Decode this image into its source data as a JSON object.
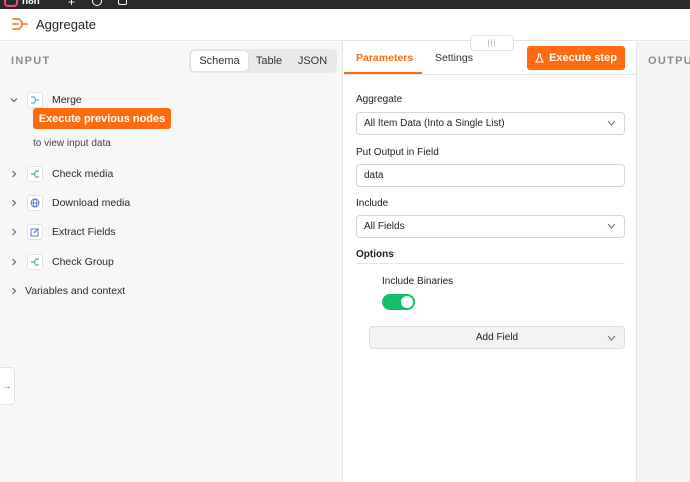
{
  "app": {
    "name": "n8n"
  },
  "header": {
    "title": "Aggregate"
  },
  "input": {
    "label": "INPUT",
    "view_options": [
      "Schema",
      "Table",
      "JSON"
    ],
    "active_view": "Schema",
    "execute_previous_label": "Execute previous nodes",
    "view_hint": "to view input data",
    "nodes": [
      {
        "label": "Merge",
        "icon": "merge-icon",
        "expanded": true
      },
      {
        "label": "Check media",
        "icon": "switch-icon",
        "expanded": false
      },
      {
        "label": "Download media",
        "icon": "globe-icon",
        "expanded": false
      },
      {
        "label": "Extract Fields",
        "icon": "edit-icon",
        "expanded": false
      },
      {
        "label": "Check Group",
        "icon": "switch-icon",
        "expanded": false
      }
    ],
    "variables_label": "Variables and context"
  },
  "params": {
    "tabs": [
      "Parameters",
      "Settings"
    ],
    "active_tab": "Parameters",
    "execute_step_label": "Execute step",
    "fields": {
      "aggregate": {
        "label": "Aggregate",
        "value": "All Item Data (Into a Single List)"
      },
      "output_field": {
        "label": "Put Output in Field",
        "value": "data"
      },
      "include": {
        "label": "Include",
        "value": "All Fields"
      }
    },
    "options": {
      "label": "Options",
      "include_binaries": {
        "label": "Include Binaries",
        "enabled": true
      },
      "add_field_label": "Add Field"
    }
  },
  "output": {
    "label": "OUTPUT"
  },
  "colors": {
    "accent": "#ff6b0f",
    "toggle_on": "#13c06a",
    "brand": "#ea4b71"
  }
}
